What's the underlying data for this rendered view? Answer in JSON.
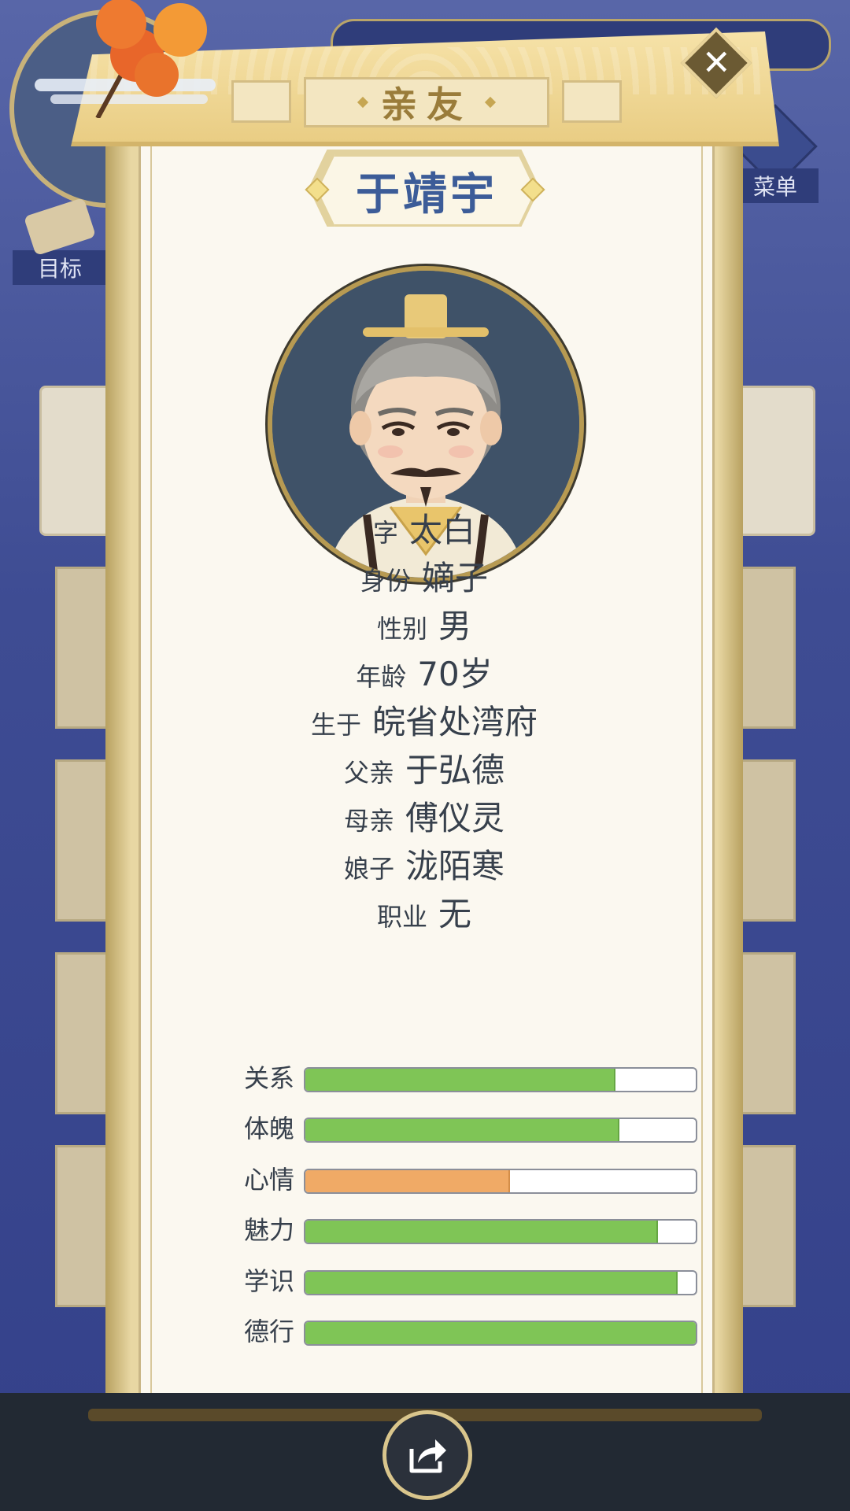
{
  "background": {
    "goal_label": "目标",
    "menu_label": "菜单"
  },
  "panel": {
    "title": "亲友",
    "name": "于靖宇"
  },
  "info": [
    {
      "key": "字",
      "value": "太白"
    },
    {
      "key": "身份",
      "value": "嫡子"
    },
    {
      "key": "性别",
      "value": "男"
    },
    {
      "key": "年龄",
      "value": "70岁"
    },
    {
      "key": "生于",
      "value": "皖省处湾府"
    },
    {
      "key": "父亲",
      "value": "于弘德"
    },
    {
      "key": "母亲",
      "value": "傅仪灵"
    },
    {
      "key": "娘子",
      "value": "泷陌寒"
    },
    {
      "key": "职业",
      "value": "无"
    }
  ],
  "stats": [
    {
      "label": "关系",
      "percent": 79,
      "color": "#7fc556"
    },
    {
      "label": "体魄",
      "percent": 80,
      "color": "#7fc556"
    },
    {
      "label": "心情",
      "percent": 52,
      "color": "#f0aa66"
    },
    {
      "label": "魅力",
      "percent": 90,
      "color": "#7fc556"
    },
    {
      "label": "学识",
      "percent": 95,
      "color": "#7fc556"
    },
    {
      "label": "德行",
      "percent": 100,
      "color": "#7fc556"
    }
  ],
  "icons": {
    "close": "close-icon",
    "share": "share-icon"
  }
}
